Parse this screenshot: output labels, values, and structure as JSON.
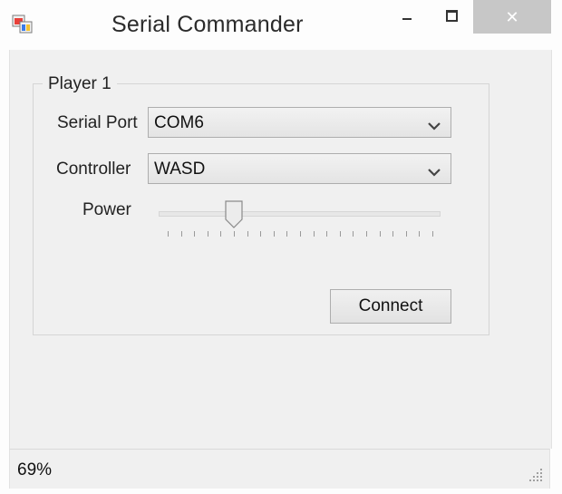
{
  "window": {
    "title": "Serial Commander",
    "icon": "application-icon",
    "controls": {
      "minimize": "minimize-icon",
      "maximize": "maximize-icon",
      "close": "✕"
    }
  },
  "group": {
    "title": "Player 1"
  },
  "serial_port": {
    "label": "Serial Port",
    "value": "COM6"
  },
  "controller": {
    "label": "Controller",
    "value": "WASD"
  },
  "power": {
    "label": "Power",
    "level_fraction": 0.25,
    "tick_count": 21
  },
  "connect_button": {
    "label": "Connect"
  },
  "status": {
    "text": "69%"
  },
  "colors": {
    "close_button_bg": "#c7c7c7",
    "client_bg": "#f0f0f0",
    "titlebar_bg": "#fdfdfd"
  }
}
